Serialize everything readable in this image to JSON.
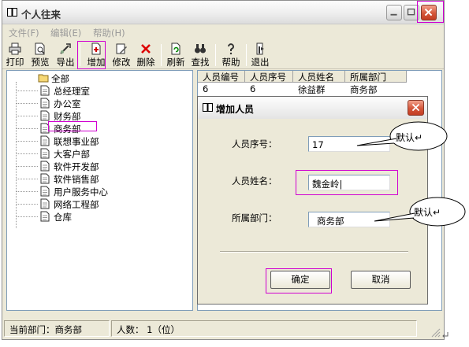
{
  "window": {
    "title": "个人往来",
    "menu": [
      "文件(F)",
      "编辑(E)",
      "帮助(H)"
    ],
    "toolbar": [
      {
        "label": "打印",
        "icon": "printer-icon"
      },
      {
        "label": "预览",
        "icon": "preview-icon"
      },
      {
        "label": "导出",
        "icon": "export-icon"
      },
      {
        "label": "增加",
        "icon": "add-icon"
      },
      {
        "label": "修改",
        "icon": "edit-icon"
      },
      {
        "label": "删除",
        "icon": "delete-icon"
      },
      {
        "label": "刷新",
        "icon": "refresh-icon"
      },
      {
        "label": "查找",
        "icon": "find-icon"
      },
      {
        "label": "帮助",
        "icon": "help-icon"
      },
      {
        "label": "退出",
        "icon": "exit-icon"
      }
    ]
  },
  "tree": {
    "root": "全部",
    "items": [
      "总经理室",
      "办公室",
      "财务部",
      "商务部",
      "联想事业部",
      "大客户部",
      "软件开发部",
      "软件销售部",
      "用户服务中心",
      "网络工程部",
      "仓库"
    ],
    "selected": "商务部"
  },
  "list": {
    "columns": [
      "人员编号",
      "人员序号",
      "人员姓名",
      "所属部门"
    ],
    "rows": [
      [
        "6",
        "6",
        "徐益群",
        "商务部"
      ]
    ]
  },
  "status": {
    "department": "当前部门：商务部",
    "count": "人数： 1（位）"
  },
  "dialog": {
    "title": "增加人员",
    "fields": [
      {
        "label": "人员序号：",
        "value": "17"
      },
      {
        "label": "人员姓名：",
        "value": "魏金岭|"
      },
      {
        "label": "所属部门：",
        "value": "商务部"
      }
    ],
    "ok_label": "确定",
    "cancel_label": "取消"
  },
  "annotations": {
    "callout_1": "默认↵",
    "callout_2": "默认↵"
  },
  "colors": {
    "highlight": "#d000d0",
    "window_bg": "#ece9d8",
    "close_button": "#d4563a"
  }
}
